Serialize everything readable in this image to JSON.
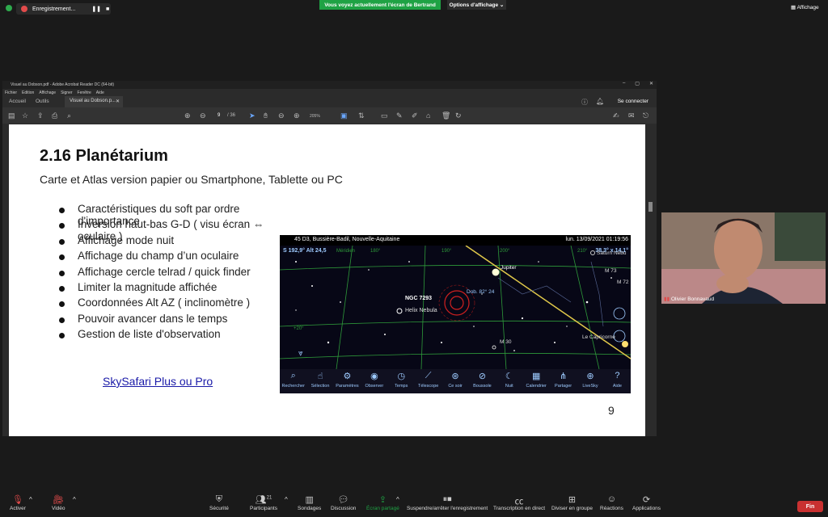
{
  "zoom_top": {
    "recording": "Enregistrement...",
    "share_banner": "Vous voyez actuellement l'écran de Bertrand",
    "view_options": "Options d'affichage",
    "affichage": "Affichage"
  },
  "acrobat": {
    "title": "Visuel au Dobson.pdf - Adobe Acrobat Reader DC (64-bit)",
    "menu": [
      "Fichier",
      "Edition",
      "Affichage",
      "Signer",
      "Fenêtre",
      "Aide"
    ],
    "tabs": [
      "Accueil",
      "Outils"
    ],
    "doc_tab": "Visuel au Dobson.p...",
    "page_current": "9",
    "page_total": "/ 36",
    "zoom": "205%",
    "signin": "Se connecter"
  },
  "slide": {
    "title": "2.16 Planétarium",
    "subtitle": "Carte et Atlas version papier ou Smartphone, Tablette ou PC",
    "bullets": [
      "Caractéristiques du soft par ordre d'importance",
      "Inversion haut-bas G-D ( visu écran ⇔ oculaire )",
      "Affichage mode nuit",
      "Affichage du champ d’un oculaire",
      "Affichage cercle telrad / quick finder",
      "Limiter la magnitude affichée",
      "Coordonnées Alt AZ ( inclinomètre )",
      "Pouvoir avancer dans le temps",
      "Gestion de liste d'observation"
    ],
    "link": "SkySafari Plus ou Pro",
    "page_number": "9"
  },
  "skysafari": {
    "location": "45 D3, Bussière-Badil, Nouvelle-Aquitaine",
    "datetime": "lun. 13/09/2021  01:19:56",
    "coords_left": "S  192,9° Alt 24,5",
    "coords_right": "38,3° x 14,1°",
    "labels": {
      "ngc": "NGC 7293",
      "helix": "Helix Nebula",
      "dob": "Dob. 82° 24",
      "jupiter": "Jupiter",
      "saturn": "Saturn Nebu",
      "m73": "M 73",
      "m72": "M 72",
      "m30": "M 30",
      "capricorne": "Le Capricorne",
      "meridien": "Méridien",
      "deg180": "180°",
      "deg190": "190°",
      "deg200": "200°",
      "deg210": "210°",
      "plus20": "+20°"
    },
    "buttons": [
      "Rechercher",
      "Sélection",
      "Paramètres",
      "Observer",
      "Temps",
      "Télescope",
      "Ce soir",
      "Boussole",
      "Nuit",
      "Calendrier",
      "Partager",
      "LiveSky",
      "Aide"
    ]
  },
  "participant": {
    "name": "Olivier Bonnavaud"
  },
  "zoom_bottom": {
    "activer": "Activer",
    "video": "Vidéo",
    "securite": "Sécurité",
    "participants": "Participants",
    "participants_count": "21",
    "sondages": "Sondages",
    "discussion": "Discussion",
    "ecran_partage": "Écran partagé",
    "suspendre": "Suspendre/arrêter l'enregistrement",
    "transcription": "Transcription en direct",
    "diviser": "Diviser en groupe",
    "reactions": "Réactions",
    "applications": "Applications",
    "fin": "Fin"
  },
  "colors": {
    "share_green": "#1fa244",
    "end_red": "#c93131",
    "link_blue": "#1a1aa8",
    "sky_cyan": "#9ecbff"
  }
}
